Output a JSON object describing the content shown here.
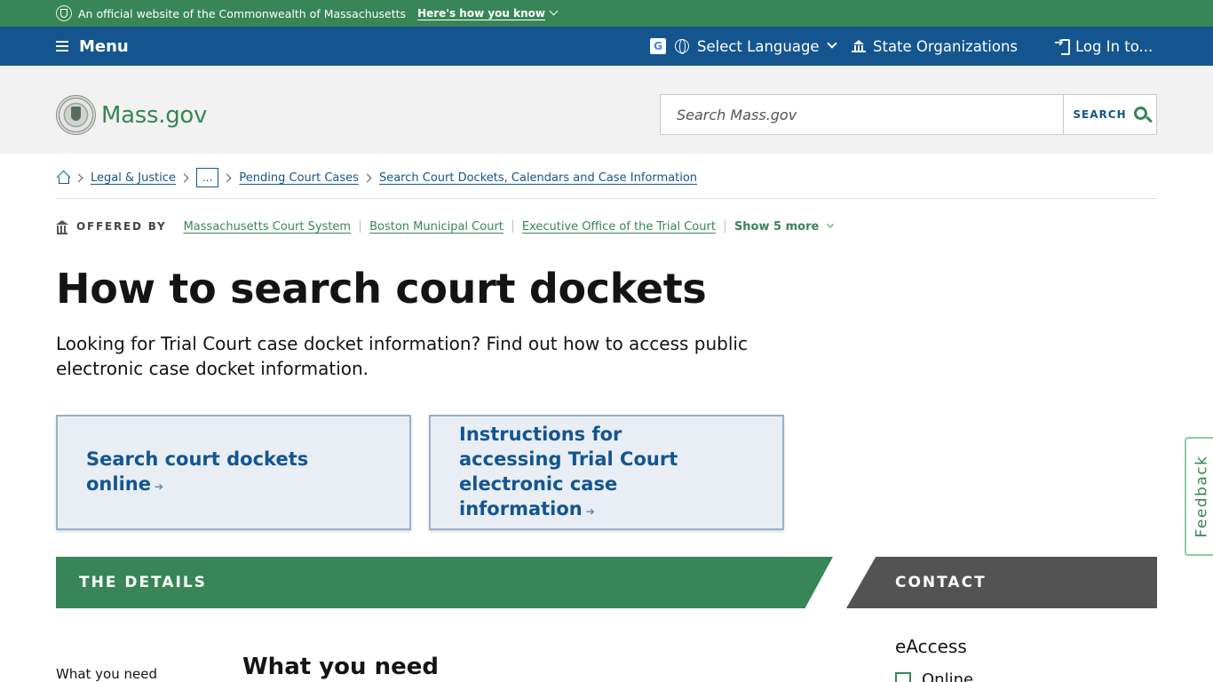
{
  "official_banner": {
    "text": "An official website of the Commonwealth of Massachusetts",
    "link": "Here's how you know"
  },
  "utility_nav": {
    "menu_label": "Menu",
    "language_label": "Select Language",
    "google_icon_letter": "G",
    "state_orgs_label": "State Organizations",
    "login_label": "Log In to..."
  },
  "header": {
    "logo_text": "Mass.gov",
    "search_placeholder": "Search Mass.gov",
    "search_button": "SEARCH"
  },
  "breadcrumb": {
    "items": [
      "Legal & Justice",
      "...",
      "Pending Court Cases",
      "Search Court Dockets, Calendars and Case Information"
    ]
  },
  "offered_by": {
    "label": "OFFERED BY",
    "orgs": [
      "Massachusetts Court System",
      "Boston Municipal Court",
      "Executive Office of the Trial Court"
    ],
    "show_more": "Show 5 more"
  },
  "page": {
    "title": "How to search court dockets",
    "lede": "Looking for Trial Court case docket information? Find out how to access public electronic case docket information."
  },
  "key_actions": [
    {
      "label": "Search court dockets online",
      "arrow": "➔"
    },
    {
      "label": "Instructions for accessing Trial Court electronic case information",
      "arrow": "➔"
    }
  ],
  "sections": {
    "details_header": "THE DETAILS",
    "contact_header": "CONTACT",
    "toc_first": "What you need",
    "first_section_title": "What you need",
    "contact_name": "eAccess",
    "contact_online": "Online"
  },
  "feedback_label": "Feedback",
  "colors": {
    "brand_green": "#388557",
    "nav_blue": "#14558f",
    "header_gray": "#f2f2f2",
    "action_bg": "#e8eef4",
    "contact_gray": "#535353"
  }
}
